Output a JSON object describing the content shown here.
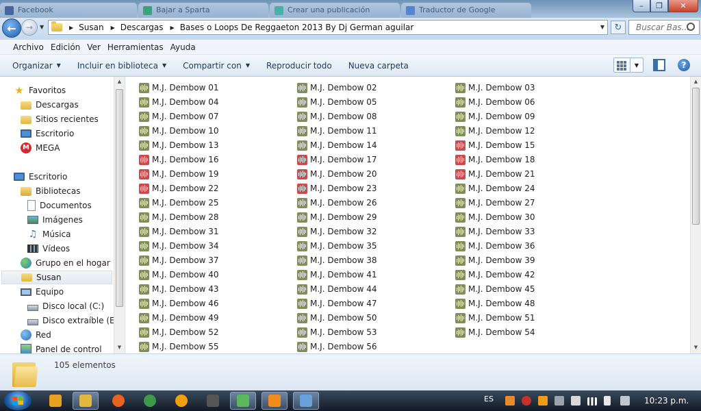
{
  "tabs": [
    {
      "label": "Facebook",
      "color": "#3b5998"
    },
    {
      "label": "Bajar a Sparta",
      "color": "#2aa36b"
    },
    {
      "label": "Crear una publicación",
      "color": "#39b3a0"
    },
    {
      "label": "Traductor de Google",
      "color": "#4a7fd6"
    }
  ],
  "window": {
    "minimize": "–",
    "maximize": "❐",
    "close": "✕"
  },
  "address": {
    "crumbs": [
      "Susan",
      "Descargas",
      "Bases o Loops De Reggaeton 2013 By Dj German aguilar"
    ],
    "search_placeholder": "Buscar Bas..."
  },
  "menu": [
    "Archivo",
    "Edición",
    "Ver",
    "Herramientas",
    "Ayuda"
  ],
  "commands": [
    {
      "label": "Organizar",
      "dropdown": true
    },
    {
      "label": "Incluir en biblioteca",
      "dropdown": true
    },
    {
      "label": "Compartir con",
      "dropdown": true
    },
    {
      "label": "Reproducir todo",
      "dropdown": false
    },
    {
      "label": "Nueva carpeta",
      "dropdown": false
    }
  ],
  "sidebar": {
    "items": [
      {
        "label": "Favoritos",
        "icon": "star-icon",
        "level": 0
      },
      {
        "label": "Descargas",
        "icon": "downloads-folder-icon",
        "level": 1
      },
      {
        "label": "Sitios recientes",
        "icon": "recent-places-icon",
        "level": 1
      },
      {
        "label": "Escritorio",
        "icon": "desktop-icon",
        "level": 1
      },
      {
        "label": "MEGA",
        "icon": "mega-icon",
        "level": 1
      },
      {
        "label": "Escritorio",
        "icon": "desktop-icon",
        "level": 0,
        "gap": true
      },
      {
        "label": "Bibliotecas",
        "icon": "libraries-icon",
        "level": 1
      },
      {
        "label": "Documentos",
        "icon": "documents-icon",
        "level": 2
      },
      {
        "label": "Imágenes",
        "icon": "pictures-icon",
        "level": 2
      },
      {
        "label": "Música",
        "icon": "music-icon",
        "level": 2
      },
      {
        "label": "Vídeos",
        "icon": "videos-icon",
        "level": 2
      },
      {
        "label": "Grupo en el hogar",
        "icon": "homegroup-icon",
        "level": 1
      },
      {
        "label": "Susan",
        "icon": "user-folder-icon",
        "level": 1,
        "selected": true
      },
      {
        "label": "Equipo",
        "icon": "computer-icon",
        "level": 1
      },
      {
        "label": "Disco local (C:)",
        "icon": "local-disk-icon",
        "level": 2
      },
      {
        "label": "Disco extraíble (E:)",
        "icon": "removable-disk-icon",
        "level": 2
      },
      {
        "label": "Red",
        "icon": "network-icon",
        "level": 1
      },
      {
        "label": "Panel de control",
        "icon": "control-panel-icon",
        "level": 1
      }
    ]
  },
  "files": {
    "prefix": "M.J. Dembow ",
    "red_numbers": [
      15,
      16,
      17,
      18,
      19,
      20,
      21,
      22,
      23
    ],
    "visible_count": 56,
    "colors": {
      "normal": "#7f8f55",
      "red": "#c84c4c"
    }
  },
  "details": {
    "count_text": "105 elementos"
  },
  "taskbar": {
    "apps": [
      {
        "name": "media-player-icon",
        "color": "#e8a020"
      },
      {
        "name": "explorer-icon",
        "color": "#e2b73e",
        "active": true
      },
      {
        "name": "firefox-icon",
        "color": "#e8631c"
      },
      {
        "name": "chrome-icon",
        "color": "#3b9a48"
      },
      {
        "name": "avast-icon",
        "color": "#f0a010"
      },
      {
        "name": "app-icon",
        "color": "#555555"
      },
      {
        "name": "windows-live-icon",
        "color": "#5cb85c",
        "active": true
      },
      {
        "name": "fl-studio-icon",
        "color": "#f28c1a",
        "active": true
      },
      {
        "name": "paint-icon",
        "color": "#6aa0d8",
        "active": true
      }
    ],
    "lang": "ES",
    "clock": "10:23 p.m."
  }
}
